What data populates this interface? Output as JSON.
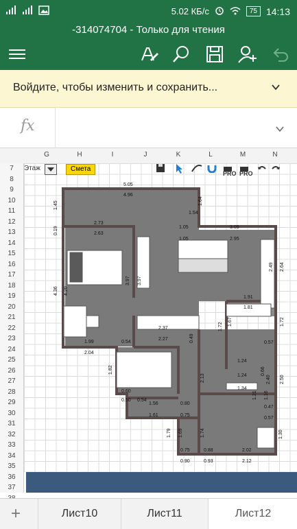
{
  "status_bar": {
    "net_speed": "5.02 КБ/с",
    "battery": "75",
    "time": "14:13"
  },
  "title": "-314074704 - Только для чтения",
  "toolbar": {
    "icons": [
      "menu-icon",
      "pen-icon",
      "search-icon",
      "save-icon",
      "share-user-icon",
      "undo-icon"
    ]
  },
  "banner": {
    "text": "Войдите, чтобы изменить и сохранить..."
  },
  "formula_bar": {
    "fx": "fx"
  },
  "columns": [
    "G",
    "H",
    "I",
    "J",
    "K",
    "L",
    "M",
    "N"
  ],
  "rows": [
    "7",
    "8",
    "9",
    "10",
    "11",
    "12",
    "13",
    "14",
    "15",
    "16",
    "17",
    "18",
    "19",
    "20",
    "21",
    "22",
    "23",
    "24",
    "25",
    "26",
    "27",
    "28",
    "29",
    "30",
    "31",
    "32",
    "33",
    "34",
    "35",
    "36",
    "37",
    "38"
  ],
  "sheet_toolbar": {
    "etazh": "Этаж",
    "smeta": "Смета",
    "pro1": "PRO",
    "pro2": "PRO"
  },
  "plan_labels": {
    "l505": "5.05",
    "l496": "4.96",
    "l273": "2.73",
    "l263": "2.63",
    "l145": "1.45",
    "l019": "0.19",
    "l164": "1.64",
    "l154": "1.54",
    "l105a": "1.05",
    "l105b": "1.05",
    "l305": "3.05",
    "l295": "2.95",
    "l436": "4.36",
    "l420": "4.20",
    "l397a": "3.97",
    "l397b": "3.97",
    "l249": "2.49",
    "l264": "2.64",
    "l191": "1.91",
    "l181": "1.81",
    "l237": "2.37",
    "l227": "2.27",
    "l199": "1.99",
    "l204": "2.04",
    "l172a": "1.72",
    "l172b": "1.72",
    "l182": "1.82",
    "l167": "1.67",
    "l124a": "1.24",
    "l124b": "1.24",
    "l134": "1.34",
    "l156": "1.56",
    "l161": "1.61",
    "l080": "0.80",
    "l075a": "0.75",
    "l075b": "0.75",
    "l179": "1.79",
    "l169": "1.69",
    "l174": "1.74",
    "l088": "0.88",
    "l202": "2.02",
    "l212": "2.12",
    "l090": "0.90",
    "l093": "0.93",
    "l240": "2.40",
    "l250": "2.50",
    "l213": "2.13",
    "l121": "1.21",
    "l116": "1.16",
    "l047": "0.47",
    "l057a": "0.57",
    "l057b": "0.57",
    "l130": "1.30",
    "l054a": "0.54",
    "l054b": "0.54",
    "l060": "0.60",
    "l050": "0.50",
    "l066": "0.66",
    "l049": "0.49"
  },
  "sheet_tabs": [
    "Лист10",
    "Лист11",
    "Лист12"
  ],
  "active_tab": "Лист12",
  "colors": {
    "accent": "#217346",
    "banner": "#fdf6d3",
    "room_fill": "#7a7a7a",
    "wall": "#5a4a4a",
    "blue_band": "#3b5a7d"
  }
}
